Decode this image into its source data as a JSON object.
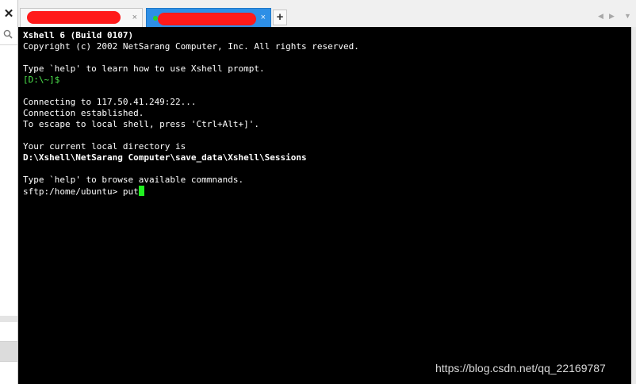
{
  "sidebar": {
    "close_glyph": "✕",
    "search_icon": "search-icon"
  },
  "tabs": [
    {
      "close_glyph": "×",
      "active": false
    },
    {
      "close_glyph": "×",
      "active": true,
      "status_color": "#2ad12a"
    }
  ],
  "tabbar": {
    "new_tab_glyph": "+",
    "scroll_left_glyph": "◀",
    "scroll_right_glyph": "▶",
    "menu_glyph": "▼"
  },
  "terminal": {
    "line1": "Xshell 6 (Build 0107)",
    "line2": "Copyright (c) 2002 NetSarang Computer, Inc. All rights reserved.",
    "line3": "Type `help' to learn how to use Xshell prompt.",
    "local_prompt": "[D:\\~]$",
    "line5": "Connecting to 117.50.41.249:22...",
    "line6": "Connection established.",
    "line7": "To escape to local shell, press 'Ctrl+Alt+]'.",
    "line8": "Your current local directory is",
    "line9": "D:\\Xshell\\NetSarang Computer\\save_data\\Xshell\\Sessions",
    "line10": "Type `help' to browse available commnands.",
    "sftp_prompt": "sftp:/home/ubuntu> ",
    "command_input": "put"
  },
  "watermark": "https://blog.csdn.net/qq_22169787",
  "colors": {
    "terminal_bg": "#000000",
    "terminal_fg": "#ffffff",
    "prompt_green": "#4ee64e",
    "cursor_green": "#22f022",
    "active_tab": "#2e8fe6",
    "redaction": "#ff1a1a"
  }
}
